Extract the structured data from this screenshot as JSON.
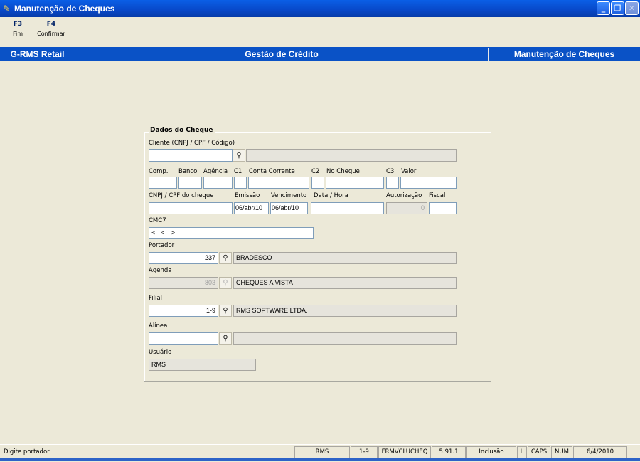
{
  "window": {
    "title": "Manutenção de Cheques",
    "icons": {
      "app": "app-icon",
      "minimize": "minimize-icon",
      "restore": "restore-icon",
      "close": "close-icon"
    }
  },
  "toolbar": [
    {
      "key": "F3",
      "label": "Fim"
    },
    {
      "key": "F4",
      "label": "Confirmar"
    }
  ],
  "header": {
    "left": "G-RMS Retail",
    "center": "Gestão de Crédito",
    "right": "Manutenção de Cheques"
  },
  "form": {
    "group_title": "Dados do Cheque",
    "cliente": {
      "label": "Cliente (CNPJ / CPF / Código)",
      "value": "",
      "desc": ""
    },
    "labels": {
      "comp": "Comp.",
      "banco": "Banco",
      "agencia": "Agência",
      "c1": "C1",
      "conta": "Conta Corrente",
      "c2": "C2",
      "no_cheque": "No Cheque",
      "c3": "C3",
      "valor": "Valor",
      "cnpj_cheque": "CNPJ / CPF do cheque",
      "emissao": "Emissão",
      "vencimento": "Vencimento",
      "data_hora": "Data / Hora",
      "autorizacao": "Autorização",
      "fiscal": "Fiscal",
      "cmc7": "CMC7",
      "portador": "Portador",
      "agenda": "Agenda",
      "filial": "Filial",
      "alinea": "Alínea",
      "usuario": "Usuário"
    },
    "values": {
      "emissao": "06/abr/10",
      "vencimento": "06/abr/10",
      "autorizacao": "0",
      "cmc7": "<   <    >    :",
      "portador_code": "237",
      "portador_desc": "BRADESCO",
      "agenda_code": "803",
      "agenda_desc": "CHEQUES A VISTA",
      "filial_code": "1-9",
      "filial_desc": "RMS SOFTWARE LTDA.",
      "alinea_code": "",
      "alinea_desc": "",
      "usuario": "RMS"
    }
  },
  "status": {
    "message": "Digite portador",
    "user": "RMS",
    "branch": "1-9",
    "form": "FRMVCLUCHEQ",
    "version": "5.91.1",
    "mode": "Inclusão",
    "l": "L",
    "caps": "CAPS",
    "num": "NUM",
    "date": "6/4/2010"
  }
}
